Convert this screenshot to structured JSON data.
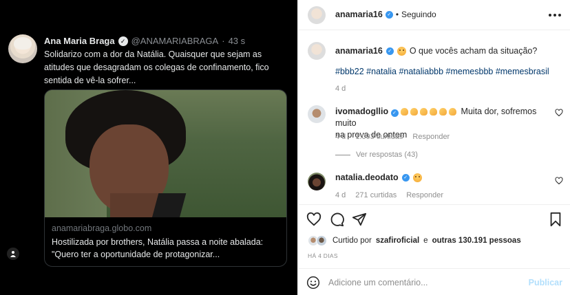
{
  "tweet": {
    "author_name": "Ana Maria Braga",
    "handle": "@ANAMARIABRAGA",
    "separator": "·",
    "time": "43 s",
    "text": "Solidarizo com a dor da Natália. Quaisquer que sejam as atitudes que desagradam os colegas de confinamento, fico sentida de vê-la sofrer...",
    "link_card": {
      "domain": "anamariabraga.globo.com",
      "title": "Hostilizada por brothers, Natália passa a noite abalada: \"Quero ter a oportunidade de protagonizar..."
    }
  },
  "header": {
    "username": "anamaria16",
    "separator": "•",
    "follow_status": "Seguindo"
  },
  "caption": {
    "username": "anamaria16",
    "text": "O que vocês acham da situação?",
    "hashtags": "#bbb22 #natalia #nataliabbb #memesbbb #memesbrasil",
    "age": "4 d"
  },
  "comments": [
    {
      "username": "ivomadogllio",
      "text_line1": "Muita dor, sofremos muito",
      "text_line2": "na prova de ontem",
      "age": "4 d",
      "likes": "1.093 curtidas",
      "reply_label": "Responder",
      "view_replies": "Ver respostas (43)"
    },
    {
      "username": "natalia.deodato",
      "age": "4 d",
      "likes": "271 curtidas",
      "reply_label": "Responder"
    }
  ],
  "likes": {
    "prefix": "Curtido por",
    "user": "szafiroficial",
    "conj": "e",
    "others": "outras 130.191 pessoas"
  },
  "posted": "HÁ 4 DIAS",
  "comment_box": {
    "placeholder": "Adicione um comentário...",
    "publish_label": "Publicar"
  },
  "colors": {
    "accent_blue": "#3897f0",
    "hashtag_blue": "#00376b",
    "publish_disabled": "#b2dffc",
    "text_primary": "#262626",
    "text_secondary": "#8e8e8e"
  }
}
